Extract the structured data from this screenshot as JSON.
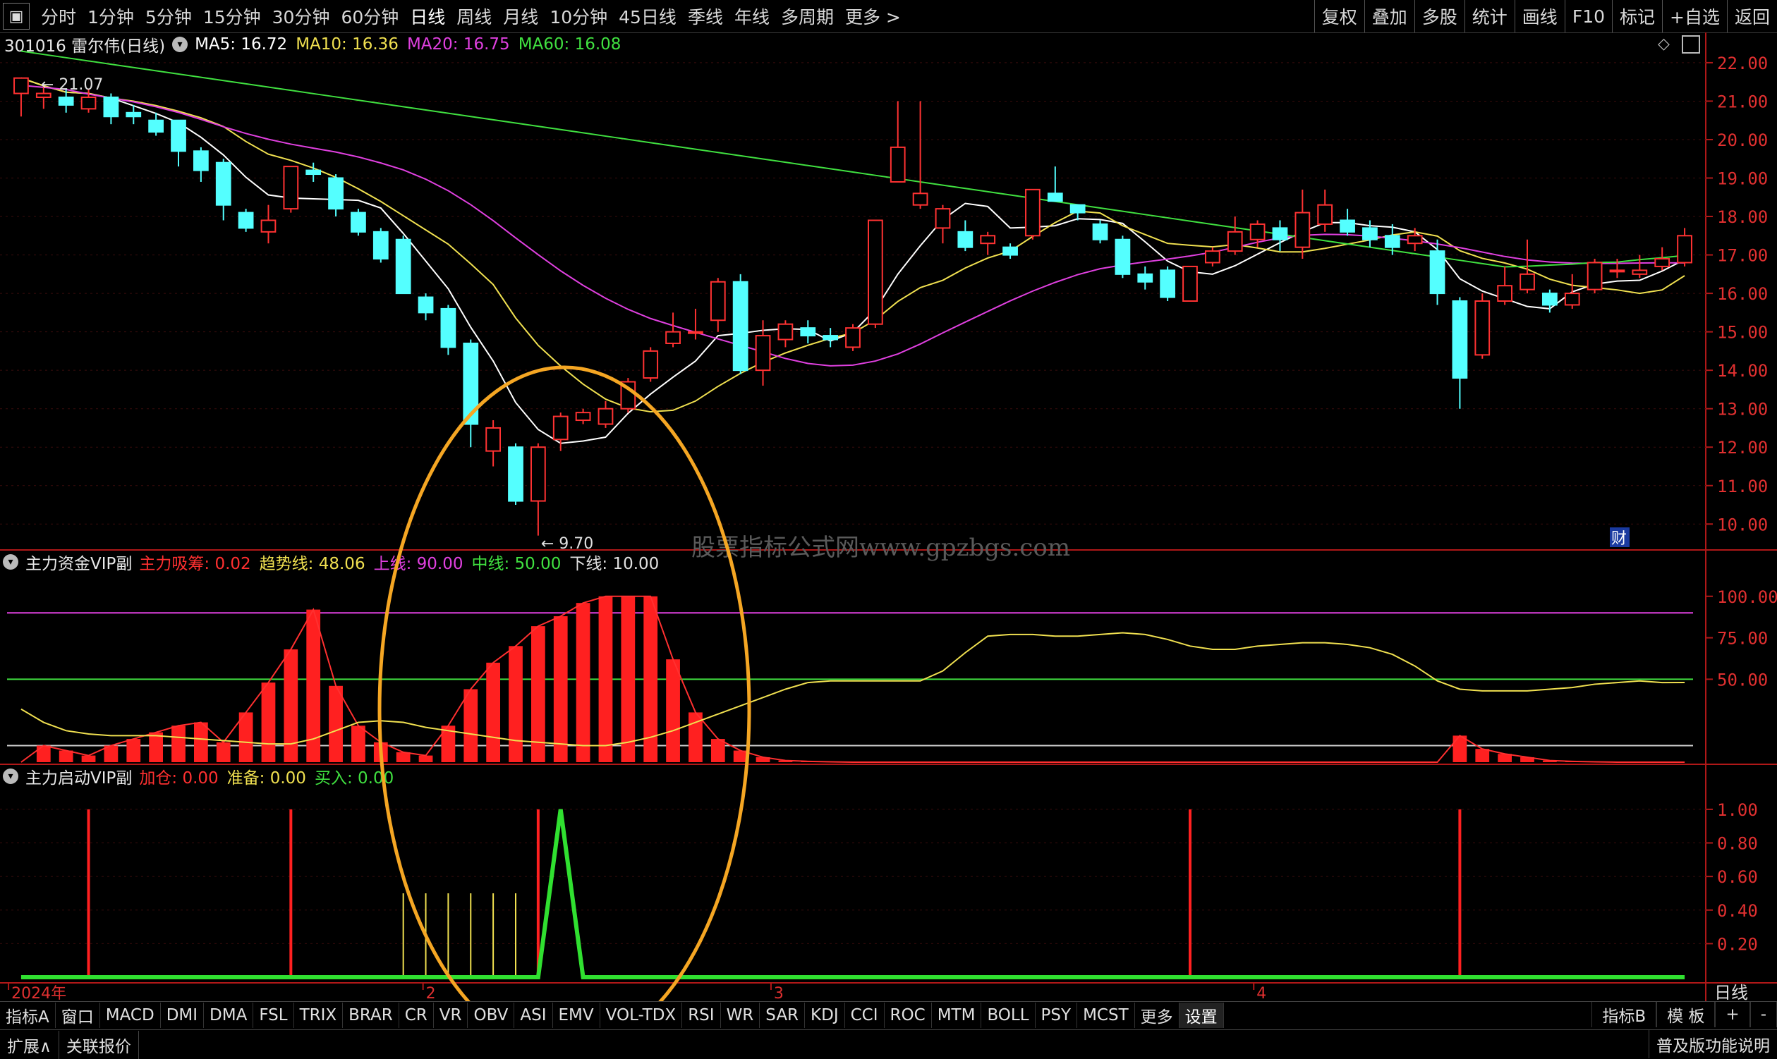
{
  "toolbar": {
    "periods": [
      "分时",
      "1分钟",
      "5分钟",
      "15分钟",
      "30分钟",
      "60分钟",
      "日线",
      "周线",
      "月线",
      "10分钟",
      "45日线",
      "季线",
      "年线",
      "多周期",
      "更多 >"
    ],
    "active_period": "日线",
    "right_buttons": [
      "复权",
      "叠加",
      "多股",
      "统计",
      "画线",
      "F10",
      "标记",
      "+自选",
      "返回"
    ]
  },
  "main_header": {
    "stock": "301016 雷尔伟(日线)",
    "ma": [
      {
        "label": "MA5: 16.72",
        "color": "#ffffff"
      },
      {
        "label": "MA10: 16.36",
        "color": "#f0e050"
      },
      {
        "label": "MA20: 16.75",
        "color": "#e040e0"
      },
      {
        "label": "MA60: 16.08",
        "color": "#40e040"
      }
    ]
  },
  "ind1_header": {
    "name": "主力资金VIP副",
    "items": [
      {
        "label": "主力吸筹: 0.02",
        "color": "#ff3030"
      },
      {
        "label": "趋势线: 48.06",
        "color": "#f0e050"
      },
      {
        "label": "上线: 90.00",
        "color": "#e040e0"
      },
      {
        "label": "中线: 50.00",
        "color": "#40e040"
      },
      {
        "label": "下线: 10.00",
        "color": "#e0e0e0"
      }
    ]
  },
  "ind2_header": {
    "name": "主力启动VIP副",
    "items": [
      {
        "label": "加仓: 0.00",
        "color": "#ff3030"
      },
      {
        "label": "准备: 0.00",
        "color": "#f0e050"
      },
      {
        "label": "买入: 0.00",
        "color": "#40e040"
      }
    ]
  },
  "watermark": "股票指标公式网www.gpzbgs.com",
  "annotations": {
    "high_label": "21.07",
    "low_label": "9.70",
    "fin_badge": "财"
  },
  "x_labels": [
    {
      "label": "2024年",
      "pos": 0.005
    },
    {
      "label": "2",
      "pos": 0.248
    },
    {
      "label": "3",
      "pos": 0.452
    },
    {
      "label": "4",
      "pos": 0.735
    }
  ],
  "x_axis_unit": "日线",
  "tabs": [
    "指标A",
    "窗口",
    "MACD",
    "DMI",
    "DMA",
    "FSL",
    "TRIX",
    "BRAR",
    "CR",
    "VR",
    "OBV",
    "ASI",
    "EMV",
    "VOL-TDX",
    "RSI",
    "WR",
    "SAR",
    "KDJ",
    "CCI",
    "ROC",
    "MTM",
    "BOLL",
    "PSY",
    "MCST",
    "更多",
    "设置"
  ],
  "right_tabs": [
    "指标B",
    "模 板",
    "+",
    "-"
  ],
  "bottom": {
    "left": [
      "扩展∧",
      "关联报价"
    ],
    "right": "普及版功能说明"
  },
  "colors": {
    "up": "#ff3232",
    "down": "#54ffff",
    "ma5": "#ffffff",
    "ma10": "#f0e050",
    "ma20": "#e040e0",
    "ma60": "#40e040",
    "axis": "#b01818",
    "highlight": "#f5a623"
  },
  "chart_data": [
    {
      "type": "candlestick",
      "title": "301016 雷尔伟(日线)",
      "y_ticks": [
        10.0,
        11.0,
        12.0,
        13.0,
        14.0,
        15.0,
        16.0,
        17.0,
        18.0,
        19.0,
        20.0,
        21.0,
        22.0
      ],
      "ylim": [
        9.4,
        22.2
      ],
      "candles": [
        [
          21.2,
          21.6,
          21.3,
          20.6
        ],
        [
          21.1,
          21.2,
          21.4,
          20.8
        ],
        [
          21.1,
          20.9,
          21.3,
          20.7
        ],
        [
          20.8,
          21.1,
          21.3,
          20.7
        ],
        [
          21.1,
          20.6,
          21.2,
          20.4
        ],
        [
          20.7,
          20.6,
          20.9,
          20.4
        ],
        [
          20.5,
          20.2,
          20.7,
          20.1
        ],
        [
          20.5,
          19.7,
          20.5,
          19.3
        ],
        [
          19.7,
          19.2,
          19.8,
          18.9
        ],
        [
          19.4,
          18.3,
          19.5,
          17.9
        ],
        [
          18.1,
          17.7,
          18.2,
          17.6
        ],
        [
          17.6,
          17.9,
          18.3,
          17.3
        ],
        [
          18.2,
          19.3,
          19.3,
          18.1
        ],
        [
          19.2,
          19.1,
          19.4,
          18.9
        ],
        [
          19.0,
          18.2,
          19.1,
          18.0
        ],
        [
          18.1,
          17.6,
          18.2,
          17.5
        ],
        [
          17.6,
          16.9,
          17.7,
          16.8
        ],
        [
          17.4,
          16.0,
          17.5,
          16.0
        ],
        [
          15.9,
          15.5,
          16.0,
          15.3
        ],
        [
          15.6,
          14.6,
          15.7,
          14.4
        ],
        [
          14.7,
          12.6,
          14.8,
          12.0
        ],
        [
          11.9,
          12.5,
          12.7,
          11.5
        ],
        [
          12.0,
          10.6,
          12.1,
          10.5
        ],
        [
          10.6,
          12.0,
          12.1,
          9.7
        ],
        [
          12.2,
          12.8,
          12.9,
          11.9
        ],
        [
          12.7,
          12.9,
          13.0,
          12.6
        ],
        [
          12.6,
          13.0,
          13.2,
          12.5
        ],
        [
          13.0,
          13.7,
          13.8,
          12.9
        ],
        [
          13.8,
          14.5,
          14.6,
          13.7
        ],
        [
          14.7,
          15.0,
          15.5,
          14.6
        ],
        [
          15.0,
          15.0,
          15.6,
          14.8
        ],
        [
          15.3,
          16.3,
          16.4,
          15.0
        ],
        [
          16.3,
          14.0,
          16.5,
          13.9
        ],
        [
          14.0,
          14.9,
          15.3,
          13.6
        ],
        [
          14.8,
          15.2,
          15.3,
          14.6
        ],
        [
          15.1,
          14.9,
          15.3,
          14.7
        ],
        [
          14.9,
          14.8,
          15.1,
          14.6
        ],
        [
          14.6,
          15.1,
          15.2,
          14.5
        ],
        [
          15.2,
          17.9,
          17.9,
          15.1
        ],
        [
          18.9,
          19.8,
          21.0,
          18.9
        ],
        [
          18.3,
          18.6,
          21.0,
          18.2
        ],
        [
          17.7,
          18.2,
          18.3,
          17.3
        ],
        [
          17.6,
          17.2,
          17.9,
          17.1
        ],
        [
          17.3,
          17.5,
          17.6,
          17.0
        ],
        [
          17.2,
          17.0,
          17.3,
          16.9
        ],
        [
          17.5,
          18.7,
          18.7,
          17.4
        ],
        [
          18.6,
          18.4,
          19.3,
          18.4
        ],
        [
          18.3,
          18.1,
          18.3,
          17.9
        ],
        [
          17.8,
          17.4,
          17.9,
          17.3
        ],
        [
          17.4,
          16.5,
          17.5,
          16.4
        ],
        [
          16.5,
          16.3,
          16.7,
          16.1
        ],
        [
          16.6,
          15.9,
          16.7,
          15.8
        ],
        [
          15.8,
          16.7,
          16.7,
          15.8
        ],
        [
          16.8,
          17.1,
          17.2,
          16.7
        ],
        [
          17.1,
          17.6,
          18.0,
          17.0
        ],
        [
          17.4,
          17.8,
          17.9,
          17.2
        ],
        [
          17.7,
          17.4,
          17.9,
          17.1
        ],
        [
          17.2,
          18.1,
          18.7,
          16.9
        ],
        [
          17.8,
          18.3,
          18.7,
          17.6
        ],
        [
          17.9,
          17.6,
          18.2,
          17.5
        ],
        [
          17.7,
          17.4,
          17.9,
          17.2
        ],
        [
          17.5,
          17.2,
          17.8,
          17.0
        ],
        [
          17.3,
          17.5,
          17.7,
          17.1
        ],
        [
          17.1,
          16.0,
          17.4,
          15.7
        ],
        [
          15.8,
          13.8,
          15.9,
          13.0
        ],
        [
          14.4,
          15.8,
          16.0,
          14.3
        ],
        [
          15.8,
          16.2,
          16.7,
          15.7
        ],
        [
          16.1,
          16.5,
          17.4,
          16.0
        ],
        [
          16.0,
          15.7,
          16.1,
          15.5
        ],
        [
          15.7,
          16.0,
          16.5,
          15.6
        ],
        [
          16.1,
          16.8,
          16.9,
          16.0
        ],
        [
          16.6,
          16.6,
          16.9,
          16.4
        ],
        [
          16.5,
          16.6,
          17.0,
          16.4
        ],
        [
          16.7,
          16.9,
          17.2,
          16.6
        ],
        [
          16.8,
          17.5,
          17.7,
          16.7
        ]
      ]
    },
    {
      "type": "bar",
      "title": "主力资金VIP副",
      "y_ticks": [
        50.0,
        75.0,
        100.0
      ],
      "ylim": [
        0,
        105
      ],
      "series": [
        {
          "name": "主力吸筹",
          "values": [
            0,
            10,
            7,
            4,
            10,
            14,
            18,
            22,
            24,
            12,
            30,
            48,
            68,
            92,
            46,
            22,
            12,
            6,
            4,
            22,
            44,
            60,
            70,
            82,
            88,
            96,
            100,
            100,
            100,
            62,
            30,
            14,
            7,
            3,
            1,
            0.5,
            0.2,
            0,
            0,
            0,
            0,
            0,
            0,
            0,
            0,
            0,
            0,
            0,
            0,
            0,
            0,
            0,
            0,
            0,
            0,
            0,
            0,
            0,
            0,
            0,
            0,
            0,
            0,
            0,
            16,
            8,
            5,
            3,
            1,
            0.5,
            0.2,
            0,
            0,
            0,
            0.02
          ]
        },
        {
          "name": "趋势线",
          "values": [
            32,
            24,
            19,
            17,
            16,
            16,
            16,
            15,
            14,
            13,
            12,
            11,
            11,
            14,
            19,
            24,
            25,
            24,
            21,
            19,
            17,
            15,
            13,
            12,
            11,
            10,
            10,
            12,
            15,
            19,
            24,
            29,
            34,
            39,
            44,
            48,
            49,
            49,
            49,
            49,
            49,
            55,
            66,
            76,
            77,
            77,
            76,
            76,
            77,
            78,
            77,
            74,
            70,
            68,
            68,
            70,
            71,
            72,
            72,
            71,
            69,
            65,
            58,
            49,
            44,
            43,
            43,
            43,
            44,
            45,
            47,
            48,
            49,
            48,
            48.06
          ]
        },
        {
          "name": "上线",
          "values": [
            90
          ]
        },
        {
          "name": "中线",
          "values": [
            50
          ]
        },
        {
          "name": "下线",
          "values": [
            10
          ]
        }
      ]
    },
    {
      "type": "bar",
      "title": "主力启动VIP副",
      "y_ticks": [
        0.2,
        0.4,
        0.6,
        0.8,
        1.0
      ],
      "ylim": [
        0,
        1.05
      ],
      "series": [
        {
          "name": "加仓",
          "values": [
            0,
            0,
            0,
            1,
            0,
            0,
            0,
            0,
            0,
            0,
            0,
            0,
            1,
            0,
            0,
            0,
            0,
            0,
            0,
            0,
            0,
            0,
            0,
            1,
            0,
            0,
            0,
            0,
            0,
            0,
            0,
            0,
            0,
            0,
            0,
            0,
            0,
            0,
            0,
            0,
            0,
            0,
            0,
            0,
            0,
            0,
            0,
            0,
            0,
            0,
            0,
            0,
            1,
            0,
            0,
            0,
            0,
            0,
            0,
            0,
            0,
            0,
            0,
            0,
            1,
            0,
            0,
            0,
            0,
            0,
            0,
            0,
            0,
            0,
            0
          ]
        },
        {
          "name": "准备",
          "values": [
            0,
            0,
            0,
            0,
            0,
            0,
            0,
            0,
            0,
            0,
            0,
            0,
            0,
            0,
            0,
            0,
            0,
            1,
            1,
            1,
            1,
            1,
            1,
            0,
            0,
            0,
            0,
            0,
            0,
            0,
            0,
            0,
            0,
            0,
            0,
            0,
            0,
            0,
            0,
            0,
            0,
            0,
            0,
            0,
            0,
            0,
            0,
            0,
            0,
            0,
            0,
            0,
            0,
            0,
            0,
            0,
            0,
            0,
            0,
            0,
            0,
            0,
            0,
            0,
            0,
            0,
            0,
            0,
            0,
            0,
            0,
            0,
            0,
            0,
            0
          ]
        },
        {
          "name": "买入",
          "values": [
            0,
            0,
            0,
            0,
            0,
            0,
            0,
            0,
            0,
            0,
            0,
            0,
            0,
            0,
            0,
            0,
            0,
            0,
            0,
            0,
            0,
            0,
            0,
            0,
            1,
            0,
            0,
            0,
            0,
            0,
            0,
            0,
            0,
            0,
            0,
            0,
            0,
            0,
            0,
            0,
            0,
            0,
            0,
            0,
            0,
            0,
            0,
            0,
            0,
            0,
            0,
            0,
            0,
            0,
            0,
            0,
            0,
            0,
            0,
            0,
            0,
            0,
            0,
            0,
            0,
            0,
            0,
            0,
            0,
            0,
            0,
            0,
            0,
            0,
            0
          ]
        }
      ]
    }
  ]
}
